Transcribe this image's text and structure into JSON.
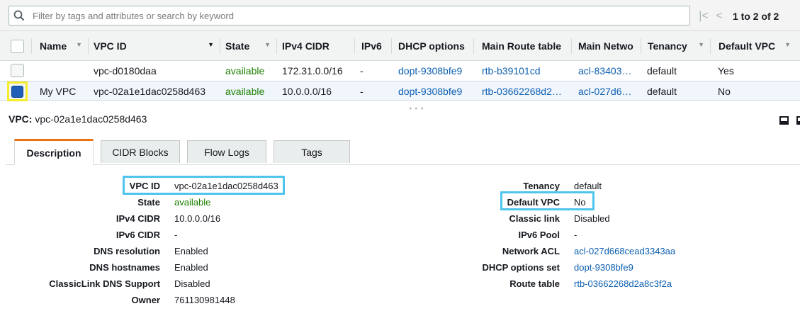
{
  "search": {
    "placeholder": "Filter by tags and attributes or search by keyword",
    "pagination": "1 to 2 of 2"
  },
  "table": {
    "columns": [
      "Name",
      "VPC ID",
      "State",
      "IPv4 CIDR",
      "IPv6",
      "DHCP options",
      "Main Route table",
      "Main Netwo",
      "Tenancy",
      "Default VPC"
    ],
    "rows": [
      {
        "name": "",
        "vpc_id": "vpc-d0180daa",
        "state": "available",
        "ipv4": "172.31.0.0/16",
        "ipv6": "-",
        "dhcp": "dopt-9308bfe9",
        "route": "rtb-b39101cd",
        "acl": "acl-83403…",
        "tenancy": "default",
        "default_vpc": "Yes",
        "selected": false
      },
      {
        "name": "My VPC",
        "vpc_id": "vpc-02a1e1dac0258d463",
        "state": "available",
        "ipv4": "10.0.0.0/16",
        "ipv6": "-",
        "dhcp": "dopt-9308bfe9",
        "route": "rtb-03662268d2…",
        "acl": "acl-027d6…",
        "tenancy": "default",
        "default_vpc": "No",
        "selected": true
      }
    ]
  },
  "detail": {
    "title_label": "VPC:",
    "title_value": "vpc-02a1e1dac0258d463",
    "tabs": [
      "Description",
      "CIDR Blocks",
      "Flow Logs",
      "Tags"
    ],
    "left": [
      {
        "label": "VPC ID",
        "value": "vpc-02a1e1dac0258d463"
      },
      {
        "label": "State",
        "value": "available"
      },
      {
        "label": "IPv4 CIDR",
        "value": "10.0.0.0/16"
      },
      {
        "label": "IPv6 CIDR",
        "value": "-"
      },
      {
        "label": "DNS resolution",
        "value": "Enabled"
      },
      {
        "label": "DNS hostnames",
        "value": "Enabled"
      },
      {
        "label": "ClassicLink DNS Support",
        "value": "Disabled"
      },
      {
        "label": "Owner",
        "value": "761130981448"
      }
    ],
    "right": [
      {
        "label": "Tenancy",
        "value": "default"
      },
      {
        "label": "Default VPC",
        "value": "No"
      },
      {
        "label": "Classic link",
        "value": "Disabled"
      },
      {
        "label": "IPv6 Pool",
        "value": "-"
      },
      {
        "label": "Network ACL",
        "value": "acl-027d668cead3343aa"
      },
      {
        "label": "DHCP options set",
        "value": "dopt-9308bfe9"
      },
      {
        "label": "Route table",
        "value": "rtb-03662268d2a8c3f2a"
      }
    ]
  },
  "colors": {
    "link": "#0c5fb0",
    "available": "#1d8102",
    "tab_accent": "#ec7211",
    "highlight_blue": "#4fc4ec",
    "highlight_yellow": "#f5ec2c",
    "selected_row": "#f1f6fd"
  },
  "icons": [
    "search-icon",
    "first-page-icon",
    "prev-page-icon",
    "sort-caret-icon",
    "resize-handle-icon",
    "pane-toggle-icon"
  ]
}
